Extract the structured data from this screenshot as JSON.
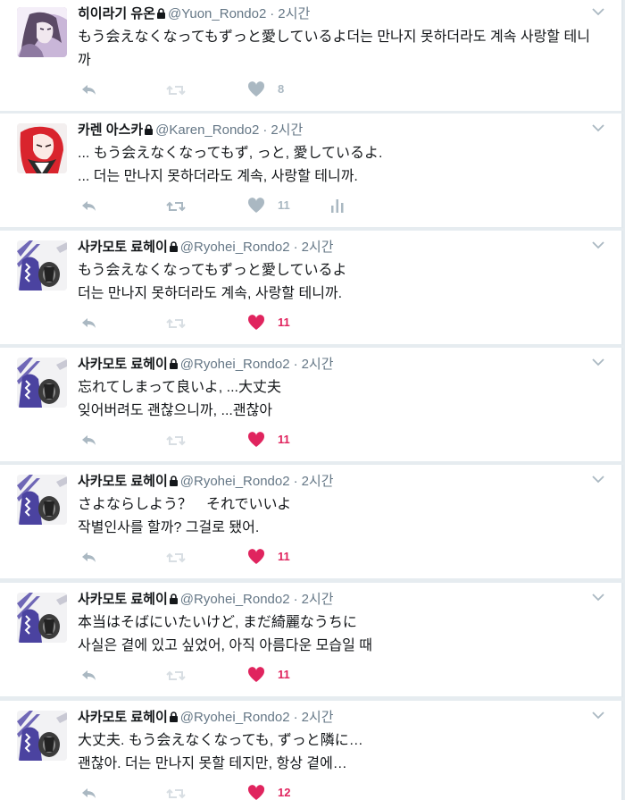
{
  "colors": {
    "text": "#14171a",
    "meta": "#657786",
    "action": "#aab8c2",
    "liked": "#e0245e",
    "retweet_active": "#b9c7d0"
  },
  "tweets": [
    {
      "name": "히이라기 유온",
      "handle": "@Yuon_Rondo2",
      "dot": "·",
      "time": "2시간",
      "avatar": "avatar-yuon",
      "text": "もう会えなくなってもずっと愛しているよ더는 만나지 못하더라도 계속 사랑할 테니까",
      "likes": "8",
      "liked": false,
      "analytics": false
    },
    {
      "name": "카렌 아스카",
      "handle": "@Karen_Rondo2",
      "dot": "·",
      "time": "2시간",
      "avatar": "avatar-karen",
      "text": "... もう会えなくなってもず, っと, 愛しているよ.\n... 더는 만나지 못하더라도 계속, 사랑할 테니까.",
      "likes": "11",
      "liked": false,
      "analytics": true
    },
    {
      "name": "사카모토 료헤이",
      "handle": "@Ryohei_Rondo2",
      "dot": "·",
      "time": "2시간",
      "avatar": "avatar-ryohei",
      "text": "もう会えなくなってもずっと愛しているよ\n더는 만나지 못하더라도 계속, 사랑할 테니까.",
      "likes": "11",
      "liked": true,
      "analytics": false
    },
    {
      "name": "사카모토 료헤이",
      "handle": "@Ryohei_Rondo2",
      "dot": "·",
      "time": "2시간",
      "avatar": "avatar-ryohei",
      "text": "忘れてしまって良いよ, ...大丈夫\n잊어버려도 괜찮으니까, ...괜찮아",
      "likes": "11",
      "liked": true,
      "analytics": false
    },
    {
      "name": "사카모토 료헤이",
      "handle": "@Ryohei_Rondo2",
      "dot": "·",
      "time": "2시간",
      "avatar": "avatar-ryohei",
      "text": "さよならしよう？　それでいいよ\n작별인사를 할까? 그걸로 됐어.",
      "likes": "11",
      "liked": true,
      "analytics": false
    },
    {
      "name": "사카모토 료헤이",
      "handle": "@Ryohei_Rondo2",
      "dot": "·",
      "time": "2시간",
      "avatar": "avatar-ryohei",
      "text": "本当はそばにいたいけど, まだ綺麗なうちに\n사실은 곁에 있고 싶었어, 아직 아름다운 모습일 때",
      "likes": "11",
      "liked": true,
      "analytics": false
    },
    {
      "name": "사카모토 료헤이",
      "handle": "@Ryohei_Rondo2",
      "dot": "·",
      "time": "2시간",
      "avatar": "avatar-ryohei",
      "text": "大丈夫. もう会えなくなっても, ずっと隣に…\n괜찮아. 더는 만나지 못할 테지만, 항상 곁에…",
      "likes": "12",
      "liked": true,
      "analytics": false
    }
  ]
}
